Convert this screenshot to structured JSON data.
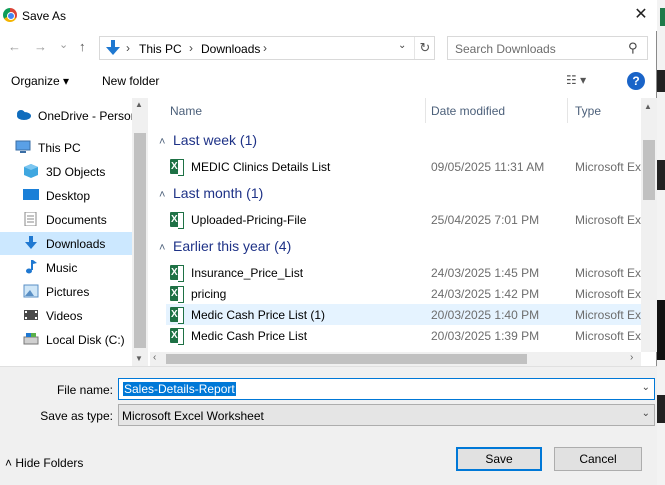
{
  "window": {
    "title": "Save As",
    "close_label": "✕"
  },
  "nav": {
    "back": "←",
    "forward": "→",
    "dropdown": "⌄",
    "up": "↑",
    "breadcrumb": [
      "This PC",
      "Downloads"
    ],
    "search_placeholder": "Search Downloads"
  },
  "toolbar": {
    "organize": "Organize ▾",
    "new_folder": "New folder",
    "view": "☷ ▾",
    "help": "?"
  },
  "sidebar": {
    "items": [
      {
        "label": "OneDrive - Person",
        "icon": "cloud-icon"
      },
      {
        "label": "This PC",
        "icon": "computer-icon"
      },
      {
        "label": "3D Objects",
        "icon": "cube-icon"
      },
      {
        "label": "Desktop",
        "icon": "desktop-icon"
      },
      {
        "label": "Documents",
        "icon": "documents-icon"
      },
      {
        "label": "Downloads",
        "icon": "download-icon",
        "selected": true
      },
      {
        "label": "Music",
        "icon": "music-icon"
      },
      {
        "label": "Pictures",
        "icon": "pictures-icon"
      },
      {
        "label": "Videos",
        "icon": "videos-icon"
      },
      {
        "label": "Local Disk (C:)",
        "icon": "disk-icon"
      }
    ]
  },
  "columns": {
    "name": "Name",
    "date": "Date modified",
    "type": "Type"
  },
  "groups": [
    {
      "label": "Last week (1)",
      "files": [
        {
          "name": "MEDIC Clinics Details List",
          "date": "09/05/2025 11:31 AM",
          "type": "Microsoft Excel Worksheet"
        }
      ]
    },
    {
      "label": "Last month (1)",
      "files": [
        {
          "name": "Uploaded-Pricing-File",
          "date": "25/04/2025 7:01 PM",
          "type": "Microsoft Excel Worksheet"
        }
      ]
    },
    {
      "label": "Earlier this year (4)",
      "files": [
        {
          "name": "Insurance_Price_List",
          "date": "24/03/2025 1:45 PM",
          "type": "Microsoft Excel Worksheet"
        },
        {
          "name": "pricing",
          "date": "24/03/2025 1:42 PM",
          "type": "Microsoft Excel Worksheet"
        },
        {
          "name": "Medic Cash Price List (1)",
          "date": "20/03/2025 1:40 PM",
          "type": "Microsoft Excel Worksheet",
          "highlighted": true
        },
        {
          "name": "Medic Cash Price List",
          "date": "20/03/2025 1:39 PM",
          "type": "Microsoft Excel Worksheet"
        }
      ]
    }
  ],
  "form": {
    "file_name_label": "File name:",
    "file_name_value": "Sales-Details-Report",
    "save_type_label": "Save as type:",
    "save_type_value": "Microsoft Excel Worksheet"
  },
  "footer": {
    "hide_folders": "Hide Folders",
    "save": "Save",
    "cancel": "Cancel"
  },
  "colors": {
    "accent": "#0078d7",
    "selection": "#cce8ff",
    "excel": "#1e7145",
    "group_heading": "#1e3287"
  }
}
